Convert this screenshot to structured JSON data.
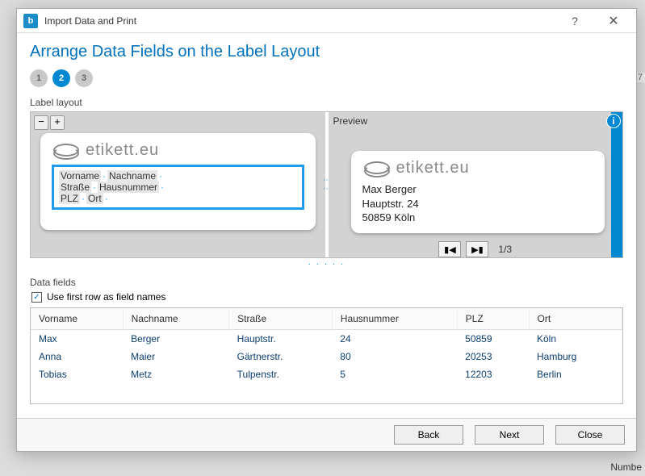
{
  "window": {
    "title": "Import Data and Print"
  },
  "heading": "Arrange Data Fields on the Label Layout",
  "steps": [
    "1",
    "2",
    "3"
  ],
  "activeStep": 2,
  "sections": {
    "labelLayout": "Label layout",
    "preview": "Preview",
    "dataFields": "Data fields"
  },
  "logoText": "etikett.eu",
  "layoutFields": {
    "row1a": "Vorname",
    "row1b": "Nachname",
    "row2a": "Straße",
    "row2b": "Hausnummer",
    "row3a": "PLZ",
    "row3b": "Ort"
  },
  "preview": {
    "line1": "Max Berger",
    "line2": "Hauptstr. 24",
    "line3": "50859 Köln",
    "counter": "1/3"
  },
  "checkbox": {
    "label": "Use first row as field names",
    "checked": true
  },
  "table": {
    "headers": [
      "Vorname",
      "Nachname",
      "Straße",
      "Hausnummer",
      "PLZ",
      "Ort"
    ],
    "rows": [
      [
        "Max",
        "Berger",
        "Hauptstr.",
        "24",
        "50859",
        "Köln"
      ],
      [
        "Anna",
        "Maier",
        "Gärtnerstr.",
        "80",
        "20253",
        "Hamburg"
      ],
      [
        "Tobias",
        "Metz",
        "Tulpenstr.",
        "5",
        "12203",
        "Berlin"
      ]
    ]
  },
  "buttons": {
    "back": "Back",
    "next": "Next",
    "close": "Close"
  }
}
